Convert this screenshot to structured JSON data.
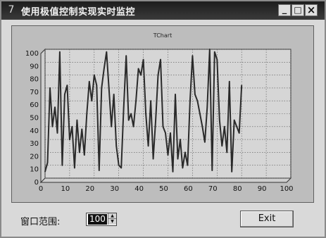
{
  "window": {
    "title": "使用极值控制实现实时监控",
    "icon": "7",
    "minimize_symbol": "_",
    "maximize_symbol": "□",
    "close_symbol": "×"
  },
  "chart_data": {
    "type": "line",
    "title": "TChart",
    "xlim": [
      0,
      100
    ],
    "ylim": [
      0,
      100
    ],
    "x_ticks": [
      "0",
      "10",
      "20",
      "30",
      "40",
      "50",
      "60",
      "70",
      "80",
      "90",
      "100"
    ],
    "y_ticks": [
      "0",
      "10",
      "20",
      "30",
      "40",
      "50",
      "60",
      "70",
      "80",
      "90",
      "100"
    ],
    "grid": true,
    "x": [
      0,
      1,
      2,
      3,
      4,
      5,
      6,
      7,
      8,
      9,
      10,
      11,
      12,
      13,
      14,
      15,
      16,
      17,
      18,
      19,
      20,
      21,
      22,
      23,
      24,
      25,
      26,
      27,
      28,
      29,
      30,
      31,
      32,
      33,
      34,
      35,
      36,
      37,
      38,
      39,
      40,
      41,
      42,
      43,
      44,
      45,
      46,
      47,
      48,
      49,
      50,
      51,
      52,
      53,
      54,
      55,
      56,
      57,
      58,
      59,
      60,
      61,
      62,
      63,
      64,
      65,
      66,
      67,
      68,
      69,
      70,
      71,
      72,
      73,
      74,
      75,
      76,
      77,
      78,
      79,
      80
    ],
    "values": [
      5,
      12,
      70,
      40,
      55,
      35,
      98,
      10,
      65,
      72,
      30,
      40,
      8,
      45,
      20,
      38,
      18,
      50,
      75,
      60,
      80,
      72,
      6,
      70,
      85,
      98,
      70,
      40,
      65,
      25,
      10,
      8,
      55,
      95,
      45,
      50,
      40,
      60,
      85,
      80,
      92,
      50,
      25,
      60,
      15,
      45,
      80,
      92,
      40,
      35,
      18,
      35,
      5,
      65,
      15,
      30,
      8,
      20,
      10,
      60,
      95,
      65,
      60,
      50,
      40,
      28,
      55,
      100,
      6,
      98,
      92,
      45,
      25,
      40,
      20,
      75,
      5,
      45,
      40,
      35,
      72
    ]
  },
  "controls": {
    "range_label": "窗口范围:",
    "range_value": "100",
    "spin_up": "▲",
    "spin_down": "▼",
    "exit_label": "Exit"
  }
}
